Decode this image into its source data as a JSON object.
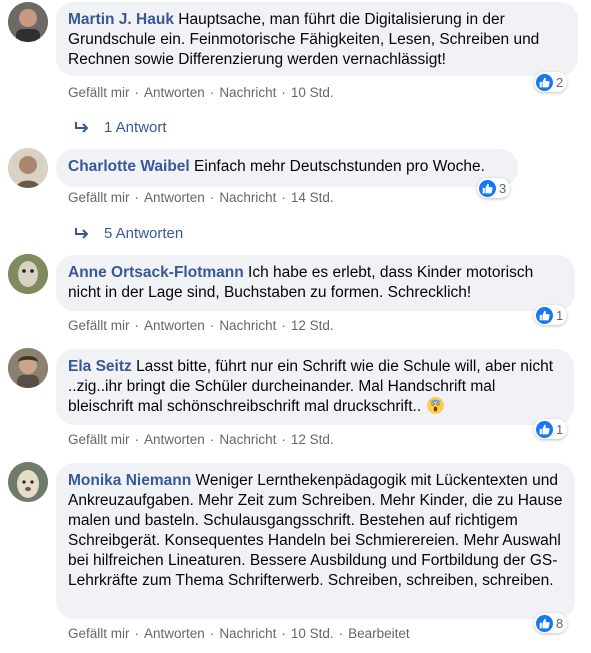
{
  "actions": {
    "like": "Gefällt mir",
    "reply": "Antworten",
    "message": "Nachricht",
    "sep": "·"
  },
  "comments": [
    {
      "author": "Martin J. Hauk",
      "text": "Hauptsache, man führt die Digitalisierung in der Grundschule ein. Feinmotorische Fähigkeiten, Lesen, Schreiben und Rechnen sowie Differenzierung werden vernachlässigt!",
      "time": "10 Std.",
      "reactions": "2",
      "replies": "1 Antwort"
    },
    {
      "author": "Charlotte Waibel",
      "text": "Einfach mehr Deutschstunden pro Woche.",
      "time": "14 Std.",
      "reactions": "3",
      "replies": "5 Antworten"
    },
    {
      "author": "Anne Ortsack-Flotmann",
      "text": "Ich habe es erlebt, dass Kinder motorisch nicht in der Lage sind, Buchstaben zu formen. Schrecklich!",
      "time": "12 Std.",
      "reactions": "1"
    },
    {
      "author": "Ela Seitz",
      "text": "Lasst bitte, führt nur ein Schrift wie die Schule will, aber nicht ..zig..ihr bringt die Schüler durcheinander. Mal Handschrift mal bleischrift mal schönschreibschrift mal druckschrift..",
      "time": "12 Std.",
      "reactions": "1"
    },
    {
      "author": "Monika Niemann",
      "text": "Weniger Lernthekenpädagogik mit Lückentexten und Ankreuzaufgaben. Mehr Zeit zum Schreiben. Mehr Kinder, die zu Hause malen und basteln. Schulausgangsschrift. Bestehen auf richtigem Schreibgerät. Konsequentes Handeln bei Schmierereien. Mehr Auswahl bei hilfreichen Lineaturen. Bessere Ausbildung und Fortbildung der GS-Lehrkräfte zum Thema Schrifterwerb. Schreiben, schreiben, schreiben.",
      "time": "10 Std.",
      "edited": "Bearbeitet",
      "reactions": "8"
    }
  ],
  "colors": {
    "author": "#385898",
    "bubble": "#f0f2f5",
    "like": "#1877f2",
    "meta": "#65676b"
  }
}
